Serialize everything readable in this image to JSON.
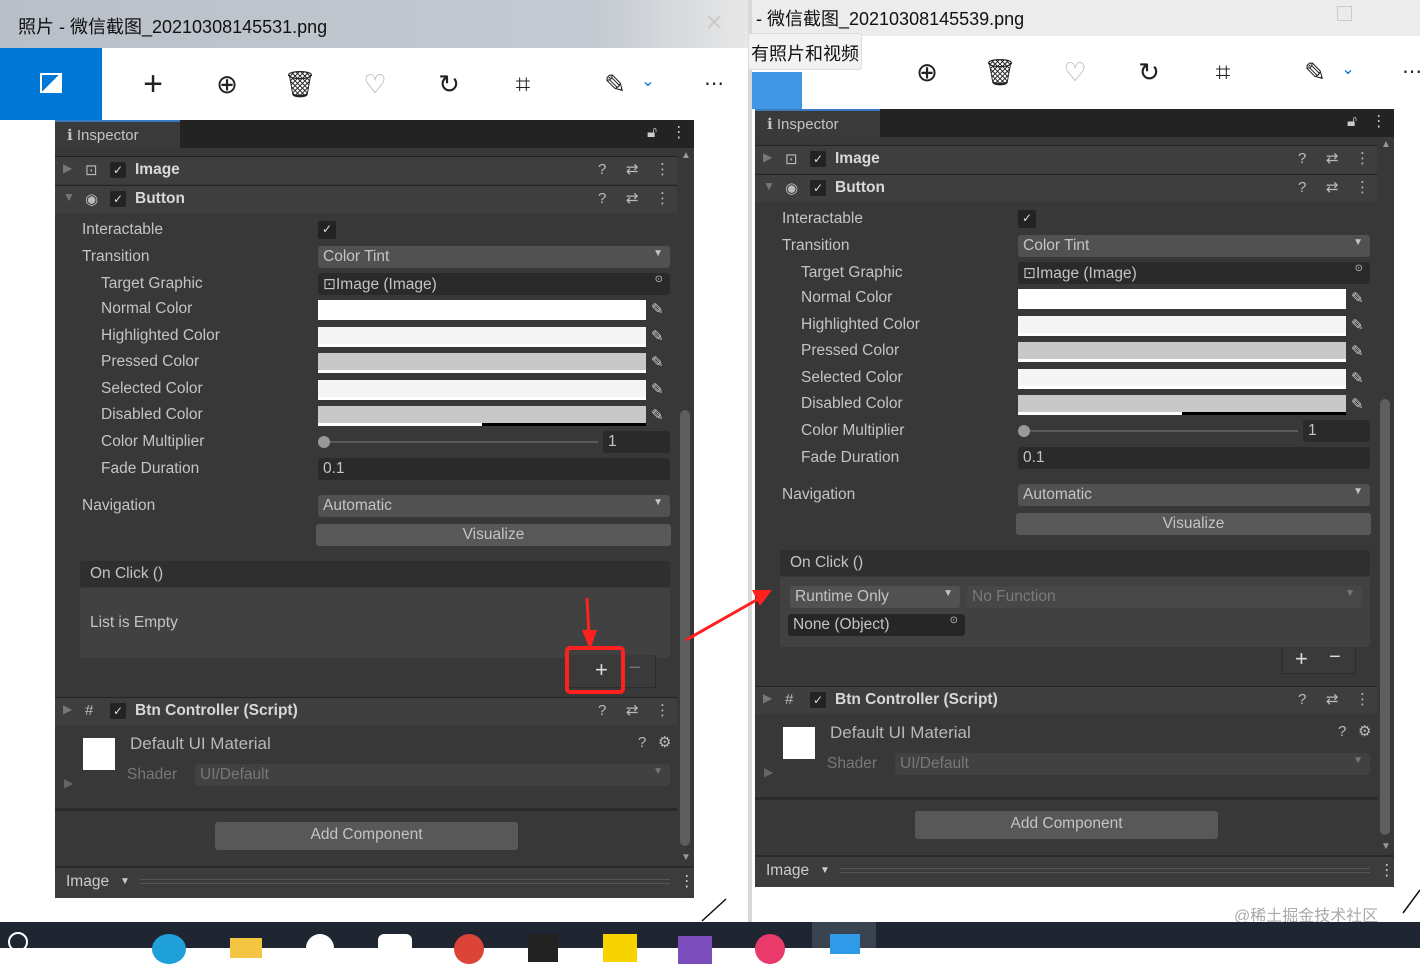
{
  "windows": [
    {
      "title": "照片 - 微信截图_20210308145531.png"
    },
    {
      "title": "- 微信截图_20210308145539.png",
      "tooltip": "有照片和视频"
    }
  ],
  "toolbar_icons": [
    "image-icon",
    "add-icon",
    "zoom-in-icon",
    "delete-icon",
    "favorite-icon",
    "rotate-icon",
    "crop-icon",
    "edit-icon",
    "chevron-down-icon",
    "more-icon"
  ],
  "watermark": "@稀土掘金技术社区",
  "inspectors": [
    {
      "tab": "Inspector",
      "image_component": "Image",
      "button_component": "Button",
      "props": {
        "interactable": "Interactable",
        "interactable_checked": true,
        "transition": "Transition",
        "transition_value": "Color Tint",
        "target_graphic": "Target Graphic",
        "target_graphic_value": "Image (Image)",
        "colors": [
          {
            "label": "Normal Color",
            "color": "#ffffff",
            "alpha": 1
          },
          {
            "label": "Highlighted Color",
            "color": "#f5f5f5",
            "alpha": 1
          },
          {
            "label": "Pressed Color",
            "color": "#c8c8c8",
            "alpha": 1
          },
          {
            "label": "Selected Color",
            "color": "#f5f5f5",
            "alpha": 1
          },
          {
            "label": "Disabled Color",
            "color": "#c8c8c8",
            "alpha": 0.5
          }
        ],
        "color_multiplier": "Color Multiplier",
        "color_multiplier_value": "1",
        "fade_duration": "Fade Duration",
        "fade_duration_value": "0.1",
        "navigation": "Navigation",
        "navigation_value": "Automatic",
        "visualize": "Visualize"
      },
      "on_click": {
        "title": "On Click ()",
        "empty_text": "List is Empty",
        "entries": []
      },
      "script_component": "Btn Controller (Script)",
      "material": "Default UI Material",
      "shader_label": "Shader",
      "shader_value": "UI/Default",
      "add_component": "Add Component",
      "bottom_label": "Image"
    },
    {
      "tab": "Inspector",
      "image_component": "Image",
      "button_component": "Button",
      "props": {
        "interactable": "Interactable",
        "interactable_checked": true,
        "transition": "Transition",
        "transition_value": "Color Tint",
        "target_graphic": "Target Graphic",
        "target_graphic_value": "Image (Image)",
        "colors": [
          {
            "label": "Normal Color",
            "color": "#ffffff",
            "alpha": 1
          },
          {
            "label": "Highlighted Color",
            "color": "#f5f5f5",
            "alpha": 1
          },
          {
            "label": "Pressed Color",
            "color": "#c8c8c8",
            "alpha": 1
          },
          {
            "label": "Selected Color",
            "color": "#f5f5f5",
            "alpha": 1
          },
          {
            "label": "Disabled Color",
            "color": "#c8c8c8",
            "alpha": 0.5
          }
        ],
        "color_multiplier": "Color Multiplier",
        "color_multiplier_value": "1",
        "fade_duration": "Fade Duration",
        "fade_duration_value": "0.1",
        "navigation": "Navigation",
        "navigation_value": "Automatic",
        "visualize": "Visualize"
      },
      "on_click": {
        "title": "On Click ()",
        "empty_text": "",
        "entries": [
          {
            "mode": "Runtime Only",
            "function": "No Function",
            "object": "None (Object)"
          }
        ]
      },
      "script_component": "Btn Controller (Script)",
      "material": "Default UI Material",
      "shader_label": "Shader",
      "shader_value": "UI/Default",
      "add_component": "Add Component",
      "bottom_label": "Image"
    }
  ],
  "colors": {
    "accent": "#0078d7",
    "annotation": "#ff2020",
    "panel": "#383838"
  }
}
